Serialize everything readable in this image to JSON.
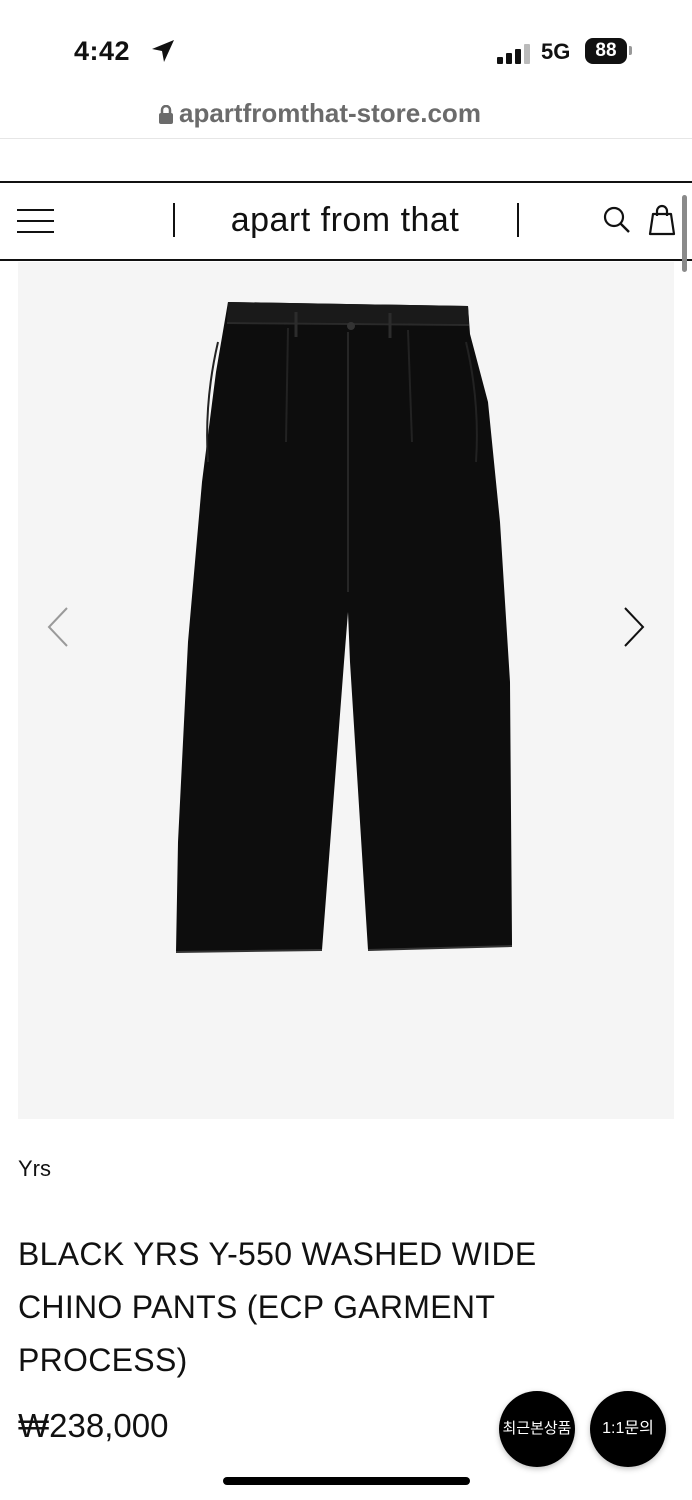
{
  "status_bar": {
    "time": "4:42",
    "network": "5G",
    "battery": "88"
  },
  "browser": {
    "url": "apartfromthat-store.com"
  },
  "header": {
    "logo": "apart from that"
  },
  "icons": {
    "menu": "hamburger-icon",
    "search": "search-icon",
    "cart": "shopping-bag-icon",
    "prev": "chevron-left-icon",
    "next": "chevron-right-icon"
  },
  "product": {
    "brand": "Yrs",
    "title": "BLACK YRS Y-550 WASHED WIDE CHINO PANTS (ECP GARMENT PROCESS)",
    "price": "₩238,000"
  },
  "floating": {
    "recent": "최근본상품",
    "inquiry": "1:1문의"
  },
  "colors": {
    "background": "#ffffff",
    "image_bg": "#f5f5f5",
    "text": "#111111",
    "fab": "#000000"
  }
}
